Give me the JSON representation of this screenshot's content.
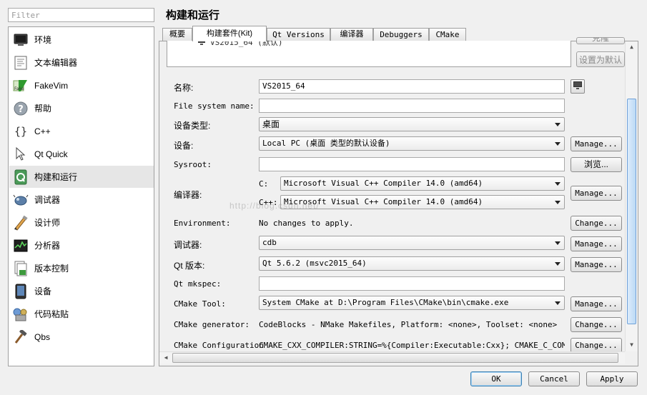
{
  "filter": {
    "placeholder": "Filter",
    "value": ""
  },
  "sidebar": {
    "items": [
      {
        "label": "环境",
        "icon": "monitor-icon"
      },
      {
        "label": "文本编辑器",
        "icon": "text-document-icon"
      },
      {
        "label": "FakeVim",
        "icon": "fakevim-icon"
      },
      {
        "label": "帮助",
        "icon": "help-icon"
      },
      {
        "label": "C++",
        "icon": "braces-icon"
      },
      {
        "label": "Qt Quick",
        "icon": "cursor-icon"
      },
      {
        "label": "构建和运行",
        "icon": "build-run-icon",
        "selected": true
      },
      {
        "label": "调试器",
        "icon": "debugger-icon"
      },
      {
        "label": "设计师",
        "icon": "designer-icon"
      },
      {
        "label": "分析器",
        "icon": "analyzer-icon"
      },
      {
        "label": "版本控制",
        "icon": "version-control-icon"
      },
      {
        "label": "设备",
        "icon": "device-icon"
      },
      {
        "label": "代码粘贴",
        "icon": "code-paste-icon"
      },
      {
        "label": "Qbs",
        "icon": "hammer-icon"
      }
    ]
  },
  "page_title": "构建和运行",
  "tabs": [
    {
      "label": "概要"
    },
    {
      "label": "构建套件(Kit)",
      "active": true
    },
    {
      "label": "Qt Versions"
    },
    {
      "label": "编译器"
    },
    {
      "label": "Debuggers"
    },
    {
      "label": "CMake"
    }
  ],
  "kit_list": {
    "partial_item": "VS2015_64 (默认)"
  },
  "side_buttons": {
    "clone_label": "克隆",
    "set_default_label": "设置为默认"
  },
  "form": {
    "name_label": "名称:",
    "name_value": "VS2015_64",
    "file_system_name_label": "File system name:",
    "file_system_name_value": "",
    "device_type_label": "设备类型:",
    "device_type_value": "桌面",
    "device_label": "设备:",
    "device_value": "Local PC (桌面 类型的默认设备)",
    "sysroot_label": "Sysroot:",
    "sysroot_value": "",
    "compiler_label": "编译器:",
    "c_label": "C:",
    "c_compiler": "Microsoft Visual C++ Compiler 14.0 (amd64)",
    "cpp_label": "C++:",
    "cpp_compiler": "Microsoft Visual C++ Compiler 14.0 (amd64)",
    "environment_label": "Environment:",
    "environment_value": "No changes to apply.",
    "debugger_label": "调试器:",
    "debugger_value": "cdb",
    "qt_version_label": "Qt 版本:",
    "qt_version_value": "Qt 5.6.2 (msvc2015_64)",
    "qt_mkspec_label": "Qt mkspec:",
    "qt_mkspec_value": "",
    "cmake_tool_label": "CMake Tool:",
    "cmake_tool_value": "System CMake at D:\\Program Files\\CMake\\bin\\cmake.exe",
    "cmake_generator_label": "CMake generator:",
    "cmake_generator_value": "CodeBlocks - NMake Makefiles, Platform: <none>, Toolset: <none>",
    "cmake_config_label": "CMake Configuration",
    "cmake_config_value": "CMAKE_CXX_COMPILER:STRING=%{Compiler:Executable:Cxx}; CMAKE_C_COMPILE…"
  },
  "buttons": {
    "manage": "Manage...",
    "browse": "浏览...",
    "change": "Change...",
    "ok": "OK",
    "cancel": "Cancel",
    "apply": "Apply"
  },
  "watermark": "http://blog.csdn.net/"
}
